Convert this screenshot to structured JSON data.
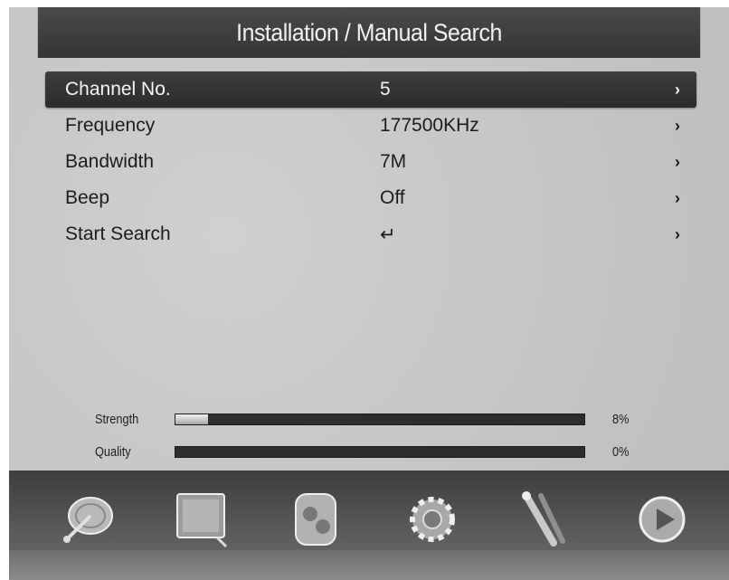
{
  "header": {
    "title": "Installation / Manual Search"
  },
  "menu": {
    "items": [
      {
        "label": "Channel No.",
        "value": "5",
        "arrow": "›",
        "selected": true
      },
      {
        "label": "Frequency",
        "value": "177500KHz",
        "arrow": "›",
        "selected": false
      },
      {
        "label": "Bandwidth",
        "value": "7M",
        "arrow": "›",
        "selected": false
      },
      {
        "label": "Beep",
        "value": "Off",
        "arrow": "›",
        "selected": false
      },
      {
        "label": "Start Search",
        "value": "↵",
        "arrow": "›",
        "selected": false
      }
    ]
  },
  "signal": {
    "strength": {
      "label": "Strength",
      "percent_text": "8%",
      "level": 0.08
    },
    "quality": {
      "label": "Quality",
      "percent_text": "0%",
      "level": 0.0
    }
  },
  "dock": {
    "icons": [
      "satellite-dish-icon",
      "tv-monitor-icon",
      "media-player-icon",
      "settings-gear-icon",
      "cable-plug-icon",
      "play-arrow-icon"
    ]
  },
  "colors": {
    "title_bar": "#3d3d3d",
    "selected_row": "#333333",
    "background": "#c8c8c8"
  }
}
